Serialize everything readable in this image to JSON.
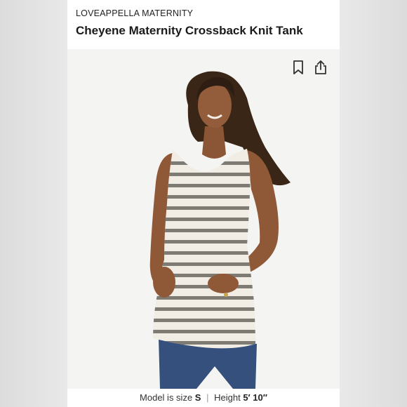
{
  "header": {
    "brand": "LOVEAPPELLA MATERNITY",
    "title": "Cheyene Maternity Crossback Knit Tank"
  },
  "actions": {
    "bookmark_icon": "bookmark-icon",
    "share_icon": "share-icon"
  },
  "caption": {
    "model_label": "Model is size",
    "model_size": "S",
    "separator": "|",
    "height_label": "Height",
    "height_value": "5′ 10″"
  },
  "colors": {
    "stripe": "#7d7b74",
    "fabric": "#f1ede4",
    "denim": "#3a5680"
  }
}
